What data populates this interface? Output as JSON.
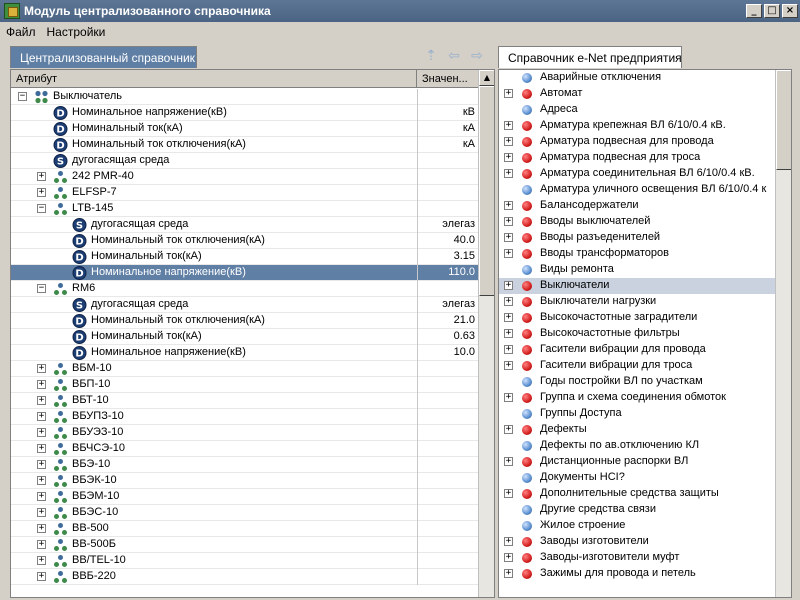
{
  "window": {
    "title": "Модуль централизованного справочника",
    "buttons": [
      "_",
      "□",
      "×"
    ]
  },
  "menu": [
    "Файл",
    "Настройки"
  ],
  "left": {
    "tab": "Централизованный справочник",
    "columns": [
      "Атрибут",
      "Значен..."
    ],
    "rows": [
      {
        "level": 0,
        "exp": "-",
        "icon": "group",
        "label": "Выключатель",
        "value": ""
      },
      {
        "level": 1,
        "exp": "",
        "icon": "D",
        "label": "Номинальное напряжение(кВ)",
        "value": "кВ"
      },
      {
        "level": 1,
        "exp": "",
        "icon": "D",
        "label": "Номинальный ток(кА)",
        "value": "кА"
      },
      {
        "level": 1,
        "exp": "",
        "icon": "D",
        "label": "Номинальный ток отключения(кА)",
        "value": "кА"
      },
      {
        "level": 1,
        "exp": "",
        "icon": "S",
        "label": "дугогасящая среда",
        "value": ""
      },
      {
        "level": 1,
        "exp": "+",
        "icon": "node",
        "label": "242 PMR-40",
        "value": ""
      },
      {
        "level": 1,
        "exp": "+",
        "icon": "node",
        "label": "ELFSP-7",
        "value": ""
      },
      {
        "level": 1,
        "exp": "-",
        "icon": "node",
        "label": "LTB-145",
        "value": ""
      },
      {
        "level": 2,
        "exp": "",
        "icon": "S",
        "label": "дугогасящая среда",
        "value": "элегаз"
      },
      {
        "level": 2,
        "exp": "",
        "icon": "D",
        "label": "Номинальный ток отключения(кА)",
        "value": "40.0"
      },
      {
        "level": 2,
        "exp": "",
        "icon": "D",
        "label": "Номинальный ток(кА)",
        "value": "3.15"
      },
      {
        "level": 2,
        "exp": "",
        "icon": "D",
        "label": "Номинальное напряжение(кВ)",
        "value": "110.0",
        "selected": true
      },
      {
        "level": 1,
        "exp": "-",
        "icon": "node",
        "label": "RM6",
        "value": ""
      },
      {
        "level": 2,
        "exp": "",
        "icon": "S",
        "label": "дугогасящая среда",
        "value": "элегаз"
      },
      {
        "level": 2,
        "exp": "",
        "icon": "D",
        "label": "Номинальный ток отключения(кА)",
        "value": "21.0"
      },
      {
        "level": 2,
        "exp": "",
        "icon": "D",
        "label": "Номинальный ток(кА)",
        "value": "0.63"
      },
      {
        "level": 2,
        "exp": "",
        "icon": "D",
        "label": "Номинальное напряжение(кВ)",
        "value": "10.0"
      },
      {
        "level": 1,
        "exp": "+",
        "icon": "node",
        "label": "ВБМ-10",
        "value": ""
      },
      {
        "level": 1,
        "exp": "+",
        "icon": "node",
        "label": "ВБП-10",
        "value": ""
      },
      {
        "level": 1,
        "exp": "+",
        "icon": "node",
        "label": "ВБТ-10",
        "value": ""
      },
      {
        "level": 1,
        "exp": "+",
        "icon": "node",
        "label": "ВБУПЗ-10",
        "value": ""
      },
      {
        "level": 1,
        "exp": "+",
        "icon": "node",
        "label": "ВБУЭЗ-10",
        "value": ""
      },
      {
        "level": 1,
        "exp": "+",
        "icon": "node",
        "label": "ВБЧСЭ-10",
        "value": ""
      },
      {
        "level": 1,
        "exp": "+",
        "icon": "node",
        "label": "ВБЭ-10",
        "value": ""
      },
      {
        "level": 1,
        "exp": "+",
        "icon": "node",
        "label": "ВБЭК-10",
        "value": ""
      },
      {
        "level": 1,
        "exp": "+",
        "icon": "node",
        "label": "ВБЭМ-10",
        "value": ""
      },
      {
        "level": 1,
        "exp": "+",
        "icon": "node",
        "label": "ВБЭС-10",
        "value": ""
      },
      {
        "level": 1,
        "exp": "+",
        "icon": "node",
        "label": "ВВ-500",
        "value": ""
      },
      {
        "level": 1,
        "exp": "+",
        "icon": "node",
        "label": "ВВ-500Б",
        "value": ""
      },
      {
        "level": 1,
        "exp": "+",
        "icon": "node",
        "label": "ВВ/TEL-10",
        "value": ""
      },
      {
        "level": 1,
        "exp": "+",
        "icon": "node",
        "label": "ВВБ-220",
        "value": ""
      }
    ]
  },
  "right": {
    "tab": "Справочник e-Net предприятия",
    "rows": [
      {
        "exp": "",
        "color": "blue",
        "label": "Аварийные отключения"
      },
      {
        "exp": "+",
        "color": "red",
        "label": "Автомат"
      },
      {
        "exp": "",
        "color": "blue",
        "label": "Адреса"
      },
      {
        "exp": "+",
        "color": "red",
        "label": "Арматура крепежная ВЛ 6/10/0.4 кВ."
      },
      {
        "exp": "+",
        "color": "red",
        "label": "Арматура подвесная для провода"
      },
      {
        "exp": "+",
        "color": "red",
        "label": "Арматура подвесная для троса"
      },
      {
        "exp": "+",
        "color": "red",
        "label": "Арматура соединительная ВЛ 6/10/0.4 кВ."
      },
      {
        "exp": "",
        "color": "blue",
        "label": "Арматура уличного освещения ВЛ 6/10/0.4 к"
      },
      {
        "exp": "+",
        "color": "red",
        "label": "Балансодержатели"
      },
      {
        "exp": "+",
        "color": "red",
        "label": "Вводы выключателей"
      },
      {
        "exp": "+",
        "color": "red",
        "label": "Вводы разъеденителей"
      },
      {
        "exp": "+",
        "color": "red",
        "label": "Вводы трансформаторов"
      },
      {
        "exp": "",
        "color": "blue",
        "label": "Виды ремонта"
      },
      {
        "exp": "+",
        "color": "red",
        "label": "Выключатели",
        "selected": true
      },
      {
        "exp": "+",
        "color": "red",
        "label": "Выключатели нагрузки"
      },
      {
        "exp": "+",
        "color": "red",
        "label": "Высокочастотные заградители"
      },
      {
        "exp": "+",
        "color": "red",
        "label": "Высокочастотные фильтры"
      },
      {
        "exp": "+",
        "color": "red",
        "label": "Гасители вибрации для провода"
      },
      {
        "exp": "+",
        "color": "red",
        "label": "Гасители вибрации для троса"
      },
      {
        "exp": "",
        "color": "blue",
        "label": "Годы постройки ВЛ по участкам"
      },
      {
        "exp": "+",
        "color": "red",
        "label": "Группа и схема соединения обмоток"
      },
      {
        "exp": "",
        "color": "blue",
        "label": "Группы Доступа"
      },
      {
        "exp": "+",
        "color": "red",
        "label": "Дефекты"
      },
      {
        "exp": "",
        "color": "blue",
        "label": "Дефекты по ав.отключению КЛ"
      },
      {
        "exp": "+",
        "color": "red",
        "label": "Дистанционные распорки ВЛ"
      },
      {
        "exp": "",
        "color": "blue",
        "label": "Документы НСI?"
      },
      {
        "exp": "+",
        "color": "red",
        "label": "Дополнительные средства защиты"
      },
      {
        "exp": "",
        "color": "blue",
        "label": "Другие средства связи"
      },
      {
        "exp": "",
        "color": "blue",
        "label": "Жилое строение"
      },
      {
        "exp": "+",
        "color": "red",
        "label": "Заводы изготовители"
      },
      {
        "exp": "+",
        "color": "red",
        "label": "Заводы-изготовители муфт"
      },
      {
        "exp": "+",
        "color": "red",
        "label": "Зажимы для провода и петель"
      }
    ]
  },
  "colors": {
    "selected": "#5f7fa5",
    "red": "#d42020",
    "blue": "#5a8fd0"
  }
}
